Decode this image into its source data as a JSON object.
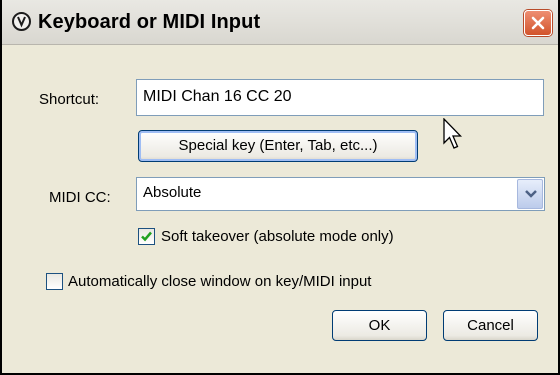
{
  "dialog": {
    "title": "Keyboard or MIDI Input",
    "icon": "reaper-app-icon",
    "close_icon": "close-icon"
  },
  "shortcut": {
    "label": "Shortcut:",
    "value": "MIDI Chan 16 CC 20"
  },
  "special_key_button": "Special key (Enter, Tab, etc...)",
  "midi_cc": {
    "label": "MIDI CC:",
    "selected": "Absolute"
  },
  "soft_takeover": {
    "label": "Soft takeover (absolute mode only)",
    "checked": true
  },
  "auto_close": {
    "label": "Automatically close window on key/MIDI input",
    "checked": false
  },
  "buttons": {
    "ok": "OK",
    "cancel": "Cancel"
  },
  "colors": {
    "close_button": "#d2542c",
    "check_mark": "#21a121",
    "input_border": "#7f9db9",
    "button_border": "#003c74"
  }
}
